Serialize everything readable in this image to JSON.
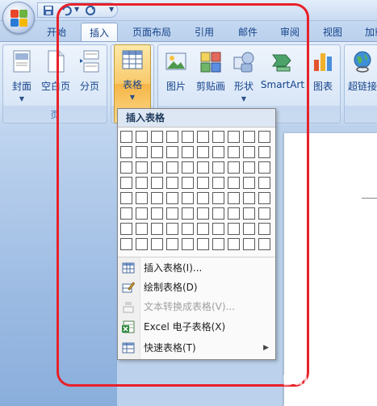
{
  "tabs": [
    {
      "label": "开始"
    },
    {
      "label": "插入"
    },
    {
      "label": "页面布局"
    },
    {
      "label": "引用"
    },
    {
      "label": "邮件"
    },
    {
      "label": "审阅"
    },
    {
      "label": "视图"
    },
    {
      "label": "加载"
    }
  ],
  "ribbon": {
    "pages_group_label": "页",
    "buttons": {
      "cover": "封面",
      "blank_page": "空白页",
      "page_break": "分页",
      "table": "表格",
      "picture": "图片",
      "clip_art": "剪贴画",
      "shapes": "形状",
      "smartart": "SmartArt",
      "chart": "图表",
      "hyperlink": "超链接"
    }
  },
  "dropdown": {
    "header": "插入表格",
    "grid_rows": 8,
    "grid_cols": 10,
    "items": [
      {
        "label": "插入表格(I)...",
        "enabled": true
      },
      {
        "label": "绘制表格(D)",
        "enabled": true
      },
      {
        "label": "文本转换成表格(V)...",
        "enabled": false
      },
      {
        "label": "Excel 电子表格(X)",
        "enabled": true
      },
      {
        "label": "快速表格(T)",
        "enabled": true
      }
    ]
  },
  "watermark": "Bai 经验",
  "colors": {
    "highlight": "#e8212a",
    "selected_button": "#f8c96a",
    "tab_text": "#15428b"
  }
}
